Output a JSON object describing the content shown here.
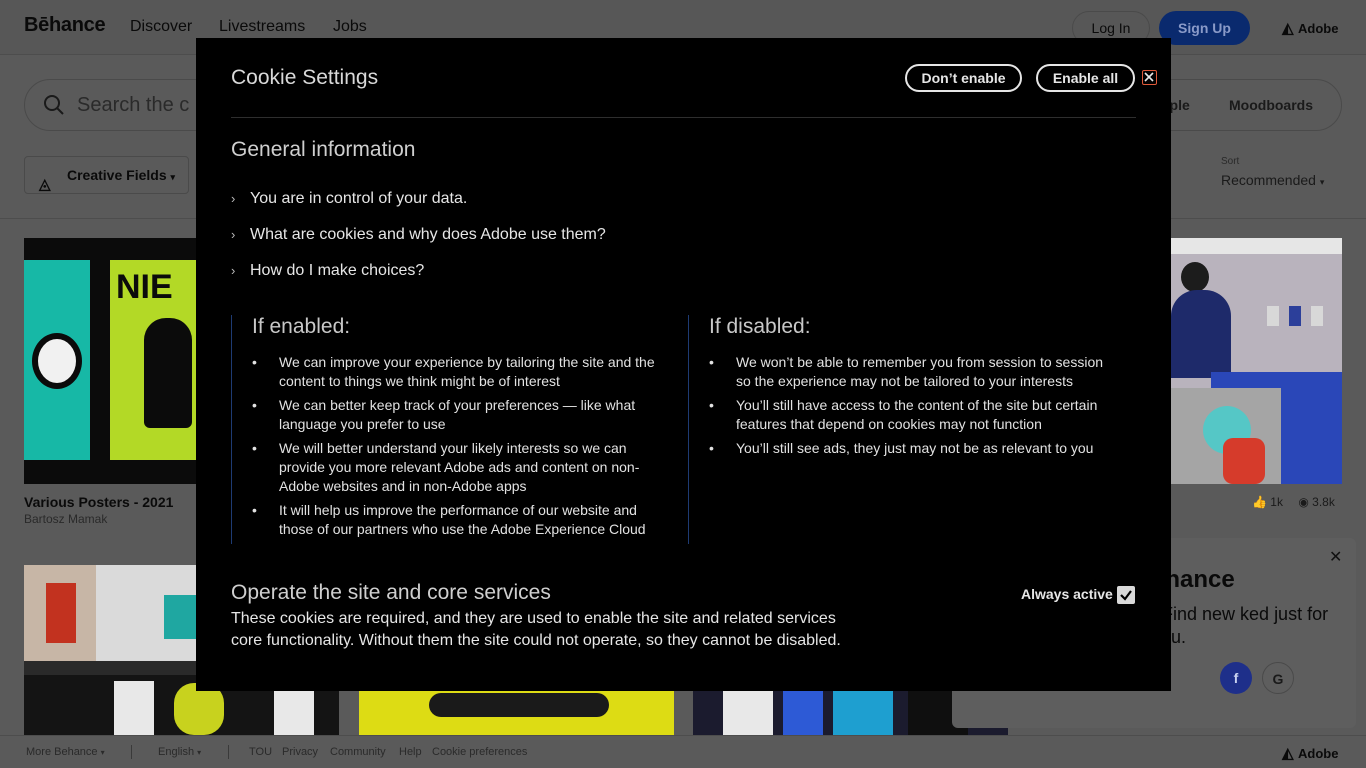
{
  "nav": {
    "logo": "Bēhance",
    "links": [
      "Discover",
      "Livestreams",
      "Jobs"
    ],
    "login": "Log In",
    "signup": "Sign Up",
    "adobe": "Adobe"
  },
  "search": {
    "placeholder": "Search the c",
    "tabs": [
      "ople",
      "Moodboards"
    ]
  },
  "filters": {
    "creative_fields": "Creative Fields",
    "sort_label": "Sort",
    "sort_value": "Recommended"
  },
  "cards": [
    {
      "title": "Various Posters - 2021",
      "owner": "Bartosz Mamak"
    }
  ],
  "stats": {
    "likes": "1k",
    "views": "3.8k"
  },
  "promo": {
    "title": "ehance",
    "subtitle": ". Find new ked just for you."
  },
  "footer": {
    "items": [
      "More Behance",
      "English",
      "TOU",
      "Privacy",
      "Community",
      "Help",
      "Cookie preferences"
    ]
  },
  "modal": {
    "title": "Cookie Settings",
    "dont_enable": "Don’t enable",
    "enable_all": "Enable all",
    "general_heading": "General information",
    "accordions": [
      "You are in control of your data.",
      "What are cookies and why does Adobe use them?",
      "How do I make choices?"
    ],
    "enabled": {
      "title": "If enabled:",
      "points": [
        "We can improve your experience by tailoring the site and the content to things we think might be of interest",
        "We can better keep track of your preferences — like what language you prefer to use",
        "We will better understand your likely interests so we can provide you more relevant Adobe ads and content on non-Adobe websites and in non-Adobe apps",
        "It will help us improve the performance of our website and those of our partners who use the Adobe Experience Cloud"
      ]
    },
    "disabled": {
      "title": "If disabled:",
      "points": [
        "We won’t be able to remember you from session to session so the experience may not be tailored to your interests",
        "You’ll still have access to the content of the site but certain features that depend on cookies may not function",
        "You’ll still see ads, they just may not be as relevant to you"
      ]
    },
    "operate": {
      "heading": "Operate the site and core services",
      "body": "These cookies are required, and they are used to enable the site and related services core functionality. Without them the site could not operate, so they cannot be disabled.",
      "always_active": "Always active",
      "checked": true
    }
  },
  "colors": {
    "modal_bg": "#000000",
    "column_rule": "#1e3b73",
    "close_accent": "#e05a3a",
    "signup_bg": "#0a2a6e"
  }
}
